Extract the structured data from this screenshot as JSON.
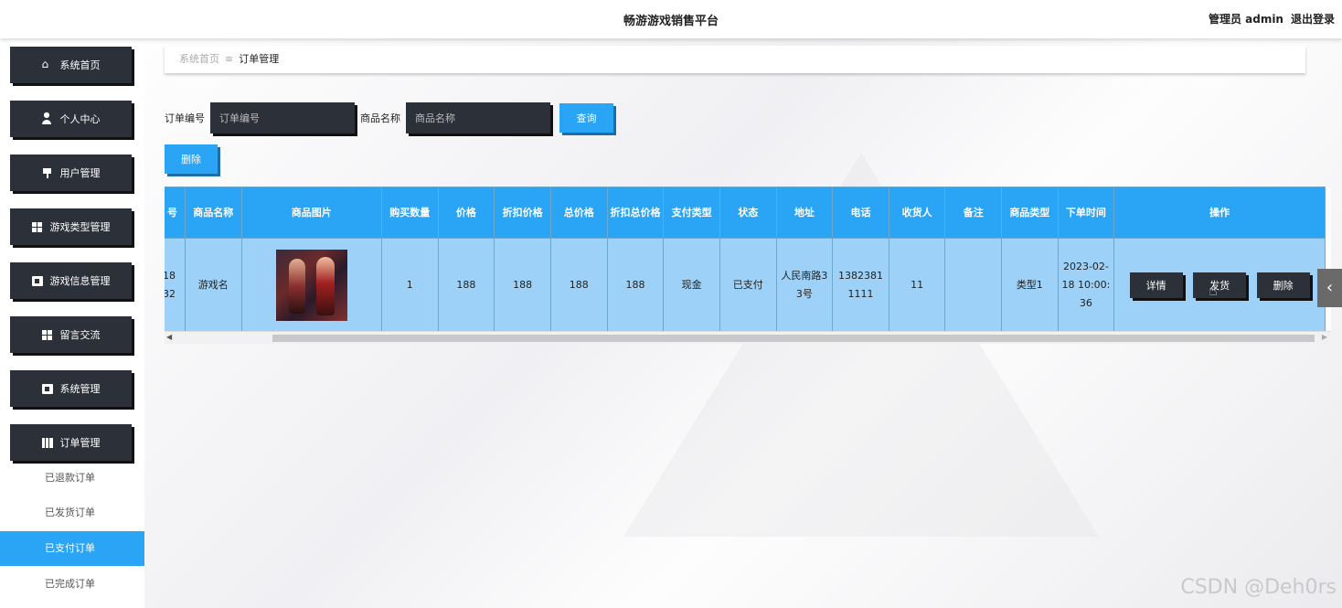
{
  "header": {
    "title": "畅游游戏销售平台",
    "role": "管理员 admin",
    "logout": "退出登录"
  },
  "sidebar": {
    "items": [
      {
        "label": "系统首页",
        "icon": "home-icon"
      },
      {
        "label": "个人中心",
        "icon": "user-icon"
      },
      {
        "label": "用户管理",
        "icon": "flag-icon"
      },
      {
        "label": "游戏类型管理",
        "icon": "grid-icon"
      },
      {
        "label": "游戏信息管理",
        "icon": "clipboard-icon"
      },
      {
        "label": "留言交流",
        "icon": "grid-icon"
      },
      {
        "label": "系统管理",
        "icon": "clipboard-icon"
      },
      {
        "label": "订单管理",
        "icon": "book-icon"
      }
    ],
    "subitems": [
      {
        "label": "已退款订单",
        "active": false
      },
      {
        "label": "已发货订单",
        "active": false
      },
      {
        "label": "已支付订单",
        "active": true
      },
      {
        "label": "已完成订单",
        "active": false
      }
    ]
  },
  "breadcrumb": {
    "home": "系统首页",
    "separator": "≡",
    "current": "订单管理"
  },
  "search": {
    "order_no_label": "订单编号",
    "order_no_placeholder": "订单编号",
    "product_label": "商品名称",
    "product_placeholder": "商品名称",
    "query_button": "查询"
  },
  "toolbar": {
    "delete_button": "删除"
  },
  "table": {
    "headers": [
      "号",
      "商品名称",
      "商品图片",
      "购买数量",
      "价格",
      "折扣价格",
      "总价格",
      "折扣总价格",
      "支付类型",
      "状态",
      "地址",
      "电话",
      "收货人",
      "备注",
      "商品类型",
      "下单时间",
      "操作"
    ],
    "rows": [
      {
        "order_no": "18\n32",
        "product_name": "游戏名",
        "quantity": "1",
        "price": "188",
        "discount_price": "188",
        "total_price": "188",
        "discount_total": "188",
        "payment_type": "现金",
        "status": "已支付",
        "address": "人民南路33号",
        "phone": "13823811111",
        "receiver": "11",
        "remark": "",
        "category": "类型1",
        "order_time": "2023-02-18 10:00:36",
        "actions": {
          "detail": "详情",
          "ship": "发货",
          "delete": "删除"
        }
      }
    ]
  },
  "watermark": "CSDN @Deh0rs",
  "colors": {
    "accent": "#2aa4f4",
    "dark": "#2c3038",
    "row_bg": "#9dd1f7"
  }
}
